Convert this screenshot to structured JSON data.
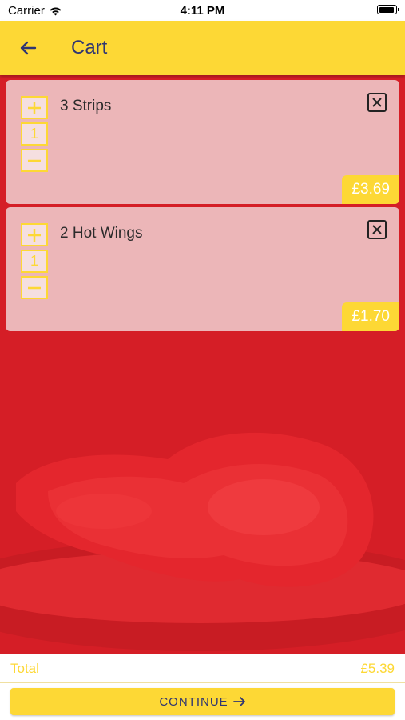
{
  "status_bar": {
    "carrier": "Carrier",
    "time": "4:11 PM"
  },
  "header": {
    "title": "Cart",
    "back_icon": "arrow-left-icon"
  },
  "cart": {
    "items": [
      {
        "name": "3 Strips",
        "quantity": "1",
        "price": "£3.69"
      },
      {
        "name": "2 Hot Wings",
        "quantity": "1",
        "price": "£1.70"
      }
    ]
  },
  "summary": {
    "total_label": "Total",
    "total_value": "£5.39"
  },
  "actions": {
    "continue_label": "CONTINUE"
  },
  "colors": {
    "accent": "#fdd835",
    "background": "#d51e26",
    "title": "#2f3572",
    "card": "#ecb6b8"
  }
}
